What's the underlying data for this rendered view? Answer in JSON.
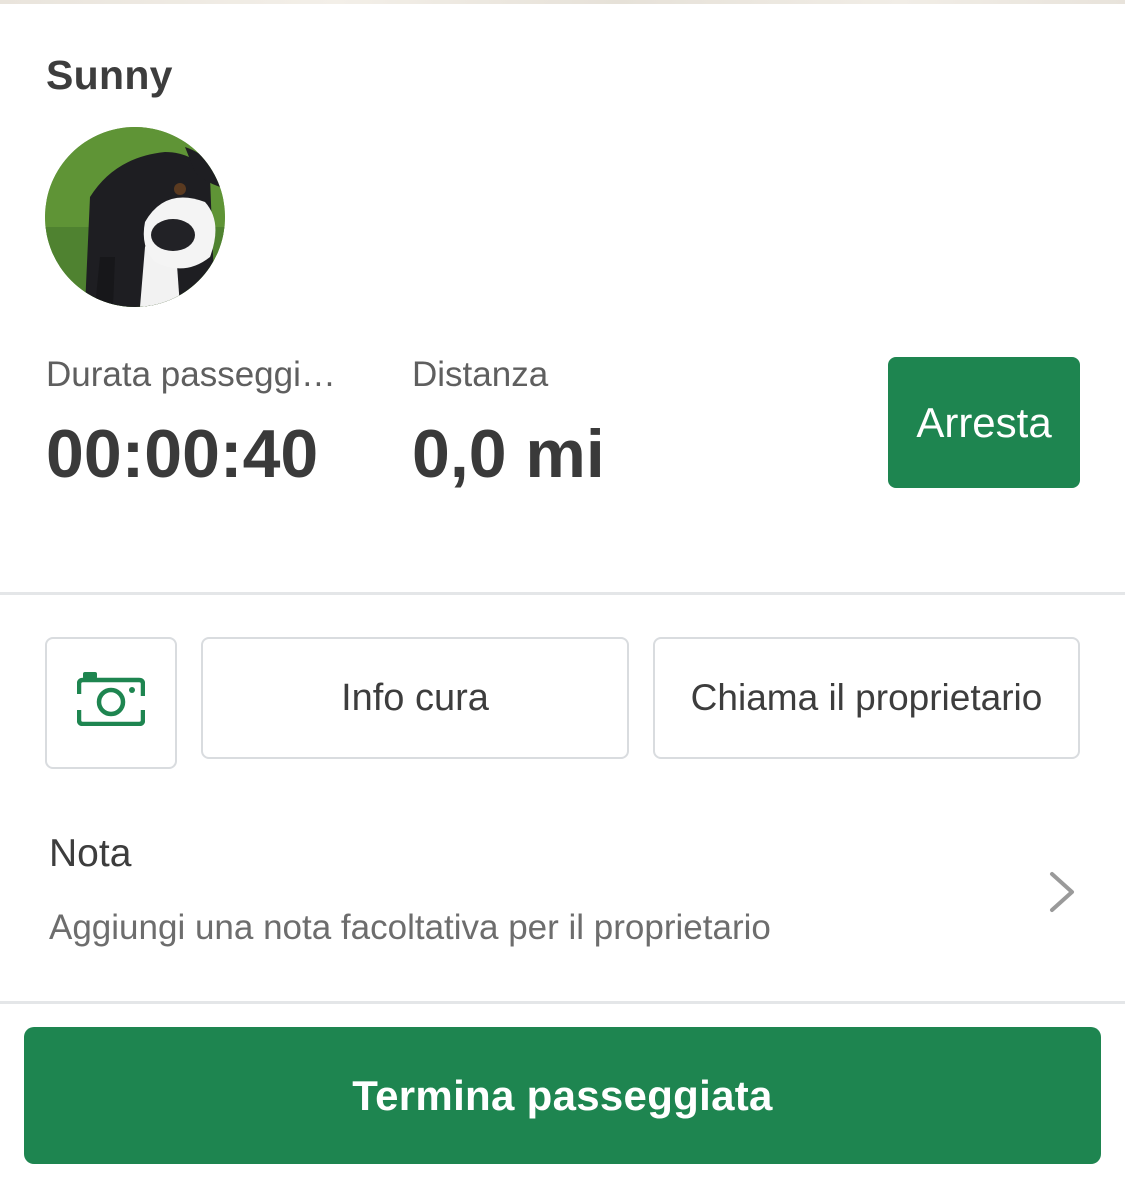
{
  "pet": {
    "name": "Sunny"
  },
  "stats": {
    "duration_label": "Durata passeggi…",
    "duration_value": "00:00:40",
    "distance_label": "Distanza",
    "distance_value": "0,0 mi"
  },
  "actions": {
    "stop_label": "Arresta",
    "camera_icon": "camera-icon",
    "care_info_label": "Info cura",
    "call_owner_label": "Chiama il proprietario"
  },
  "note": {
    "title": "Nota",
    "hint": "Aggiungi una nota facoltativa per il proprietario",
    "chevron_icon": "chevron-right-icon"
  },
  "footer": {
    "end_walk_label": "Termina passeggiata"
  },
  "colors": {
    "accent": "#1e8550",
    "divider": "#e4e6e8",
    "text": "#3d3d3d"
  }
}
